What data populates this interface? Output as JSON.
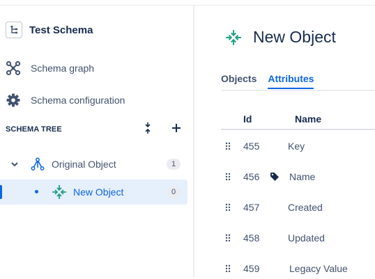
{
  "sidebar": {
    "schema_title": "Test Schema",
    "nav": [
      {
        "label": "Schema graph",
        "icon": "schema-graph-icon"
      },
      {
        "label": "Schema configuration",
        "icon": "gear-icon"
      }
    ],
    "tree_heading": "SCHEMA TREE",
    "tree": [
      {
        "label": "Original Object",
        "count": "1",
        "icon": "object-hierarchy-icon",
        "expanded": true
      },
      {
        "label": "New Object",
        "count": "0",
        "icon": "compress-arrows-icon",
        "selected": true
      }
    ]
  },
  "main": {
    "title": "New Object",
    "title_icon": "compress-arrows-icon",
    "tabs": [
      {
        "label": "Objects",
        "active": false
      },
      {
        "label": "Attributes",
        "active": true
      }
    ],
    "columns": [
      "Id",
      "Name"
    ],
    "attributes": [
      {
        "id": "455",
        "name": "Key",
        "label_tag": false
      },
      {
        "id": "456",
        "name": "Name",
        "label_tag": true
      },
      {
        "id": "457",
        "name": "Created",
        "label_tag": false
      },
      {
        "id": "458",
        "name": "Updated",
        "label_tag": false
      },
      {
        "id": "459",
        "name": "Legacy Value",
        "label_tag": false
      }
    ]
  },
  "colors": {
    "accent": "#0c66e4",
    "icon_green": "#1f9e86",
    "selected_bg": "#e6effc"
  }
}
